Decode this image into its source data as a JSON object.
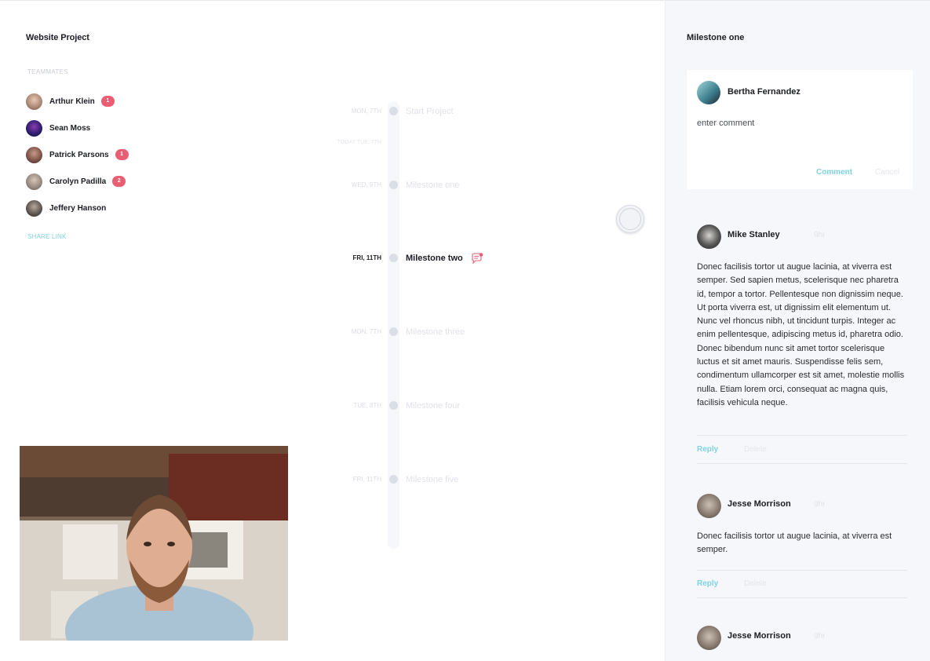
{
  "project": {
    "title": "Website Project"
  },
  "teammates": {
    "label": "TEAMMATES",
    "members": [
      {
        "name": "Arthur Klein",
        "badge": "1",
        "color": "#b58f7c"
      },
      {
        "name": "Sean Moss",
        "badge": "",
        "color": "#3b2a7a"
      },
      {
        "name": "Patrick Parsons",
        "badge": "1",
        "color": "#7a5a52"
      },
      {
        "name": "Carolyn Padilla",
        "badge": "2",
        "color": "#9c8f86"
      },
      {
        "name": "Jeffery Hanson",
        "badge": "",
        "color": "#5c554f"
      }
    ],
    "share_link": "SHARE LINK"
  },
  "timeline": {
    "today": "TODAY TUE, 7TH",
    "items": [
      {
        "date": "MON, 7TH",
        "label": "Start Project"
      },
      {
        "date": "WED, 9TH",
        "label": "Milestone one"
      },
      {
        "date": "FRI, 11TH",
        "label": "Milestone two"
      },
      {
        "date": "MON, 7TH",
        "label": "Milestone three"
      },
      {
        "date": "TUE, 8TH",
        "label": "Milestone four"
      },
      {
        "date": "FRI, 11TH",
        "label": "Milestone five"
      }
    ]
  },
  "panel": {
    "title": "Milestone one",
    "composer": {
      "author": "Bertha Fernandez",
      "value": "enter comment",
      "comment_label": "Comment",
      "cancel_label": "Cancel"
    },
    "comments": [
      {
        "author": "Mike Stanley",
        "time": "9hr",
        "body": "Donec facilisis tortor ut augue lacinia, at viverra est semper. Sed sapien metus, scelerisque nec pharetra id, tempor a tortor. Pellentesque non dignissim neque. Ut porta viverra est, ut dignissim elit elementum ut. Nunc vel rhoncus nibh, ut tincidunt turpis. Integer ac enim pellentesque, adipiscing metus id, pharetra odio. Donec bibendum nunc sit amet tortor scelerisque luctus et sit amet mauris. Suspendisse felis sem, condimentum ullamcorper est sit amet, molestie mollis nulla. Etiam lorem orci, consequat ac magna quis, facilisis vehicula neque.",
        "reply": "Reply",
        "delete": "Delete"
      },
      {
        "author": "Jesse Morrison",
        "time": "9hr",
        "body": "Donec facilisis tortor ut augue lacinia, at viverra est semper.",
        "reply": "Reply",
        "delete": "Delete"
      },
      {
        "author": "Jesse Morrison",
        "time": "9hr"
      }
    ]
  },
  "colors": {
    "accent": "#7fd3e0",
    "badge": "#ea5e73"
  }
}
